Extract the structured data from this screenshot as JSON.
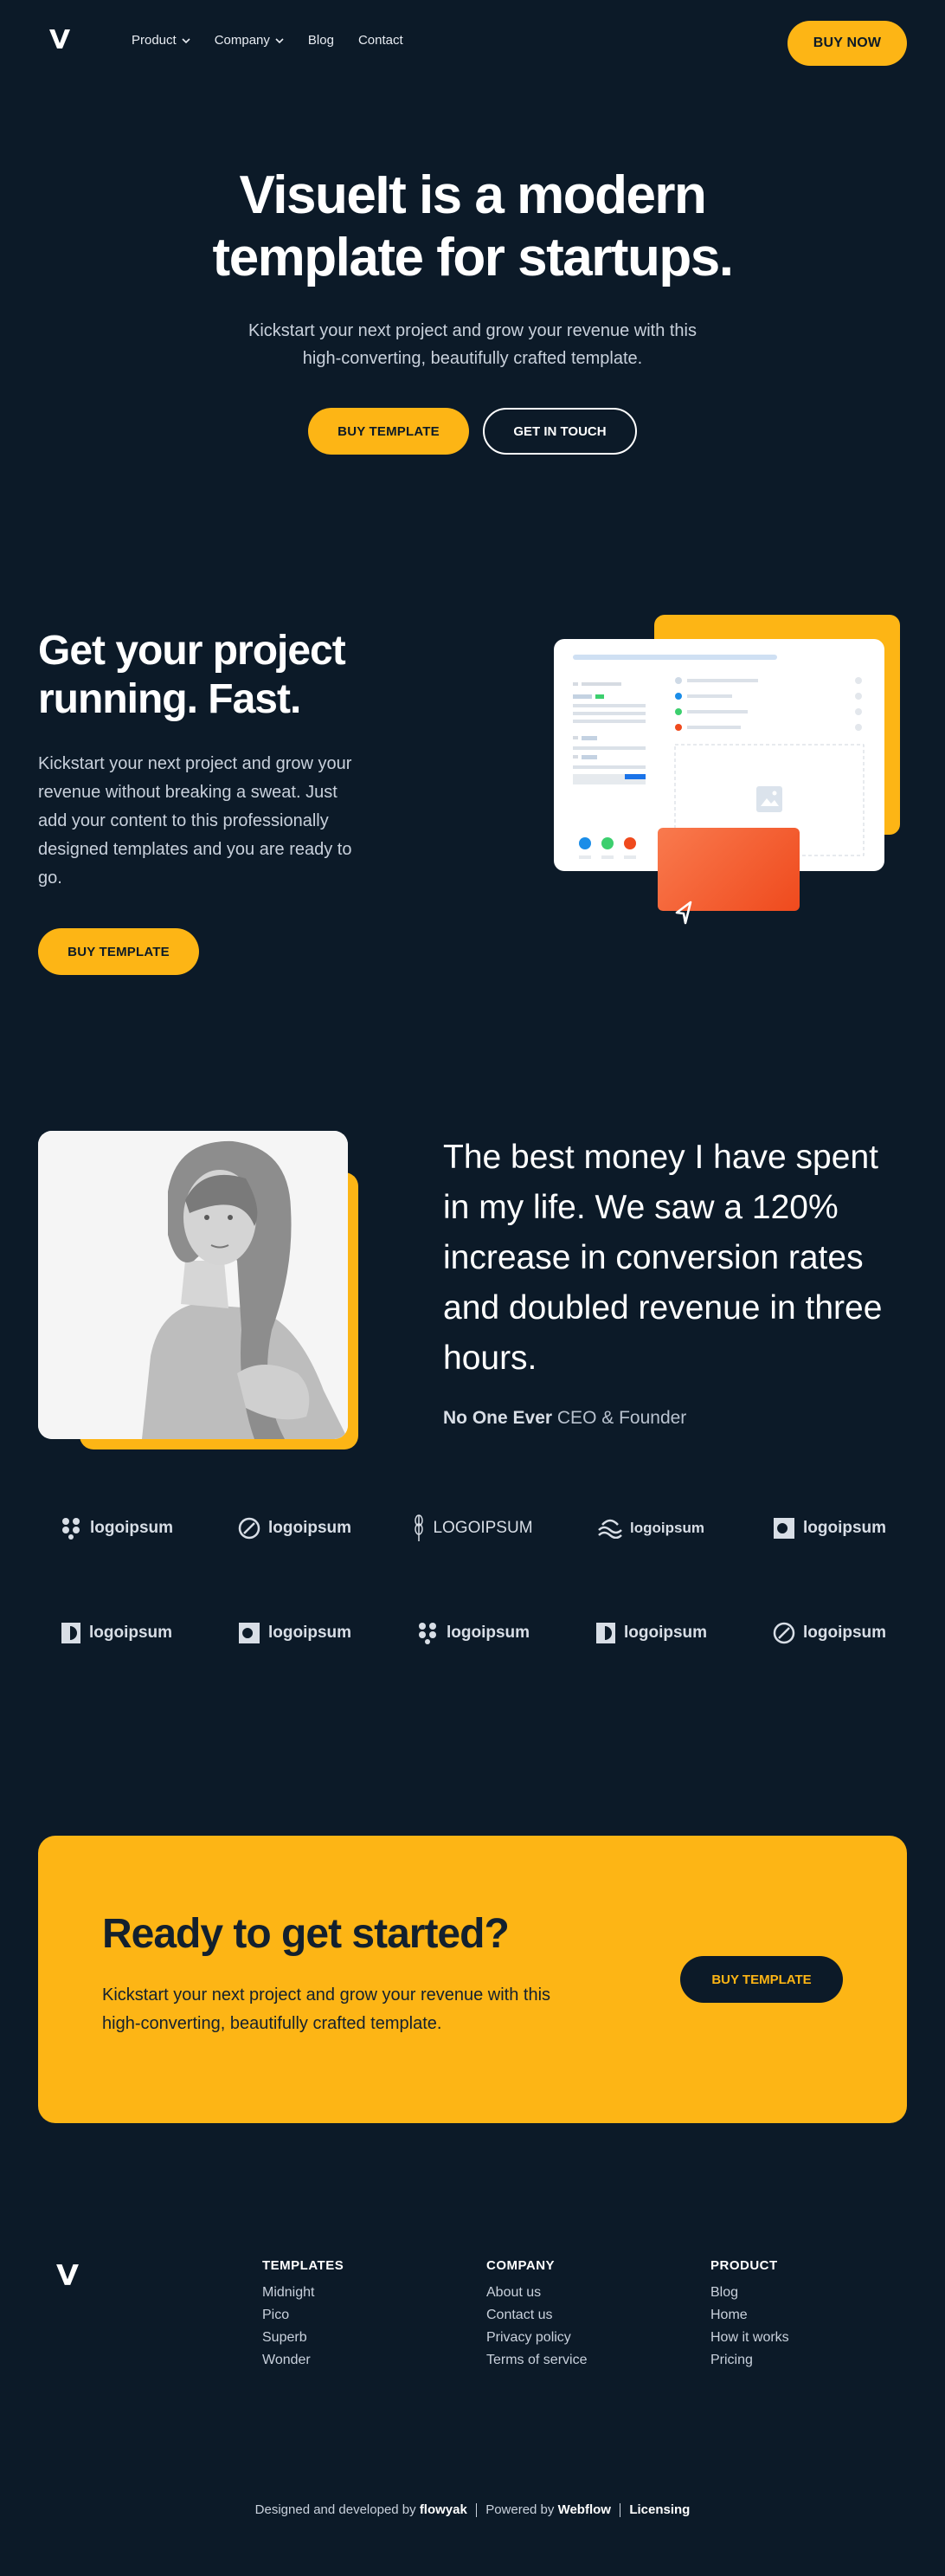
{
  "nav": {
    "product": "Product",
    "company": "Company",
    "blog": "Blog",
    "contact": "Contact",
    "buy_now": "BUY NOW"
  },
  "hero": {
    "title_line1": "VisueIt is a modern",
    "title_line2": "template for startups.",
    "subtitle": "Kickstart your next project and grow your revenue with this high-converting, beautifully crafted template.",
    "btn_primary": "BUY TEMPLATE",
    "btn_secondary": "GET IN TOUCH"
  },
  "feature": {
    "title": "Get your project running. Fast.",
    "text": "Kickstart your next project and grow your revenue without breaking a sweat. Just add your content to this professionally designed templates and you are ready to go.",
    "button": "BUY TEMPLATE"
  },
  "testimonial": {
    "quote": "The best money I have spent in my life. We saw a 120% increase in conversion rates and doubled revenue in three hours.",
    "author_name": "No One Ever",
    "author_role": "CEO & Founder"
  },
  "logos": {
    "row1": [
      "logoipsum",
      "logoipsum",
      "LOGOIPSUM",
      "logoipsum",
      "logoipsum"
    ],
    "row2": [
      "logoipsum",
      "logoipsum",
      "logoipsum",
      "logoipsum",
      "logoipsum"
    ]
  },
  "cta": {
    "title": "Ready to get started?",
    "text": "Kickstart your next project and grow your revenue with this high-converting, beautifully crafted template.",
    "button": "BUY TEMPLATE"
  },
  "footer": {
    "templates": {
      "heading": "TEMPLATES",
      "links": [
        "Midnight",
        "Pico",
        "Superb",
        "Wonder"
      ]
    },
    "company": {
      "heading": "COMPANY",
      "links": [
        "About us",
        "Contact us",
        "Privacy policy",
        "Terms of service"
      ]
    },
    "product": {
      "heading": "PRODUCT",
      "links": [
        "Blog",
        "Home",
        "How it works",
        "Pricing"
      ]
    },
    "credits_prefix": "Designed and developed by",
    "credits_flowyak": "flowyak",
    "credits_powered": "Powered by",
    "credits_webflow": "Webflow",
    "credits_licensing": "Licensing"
  },
  "colors": {
    "background": "#0c1a28",
    "accent": "#fdb515",
    "orange": "#ef4a1d"
  }
}
